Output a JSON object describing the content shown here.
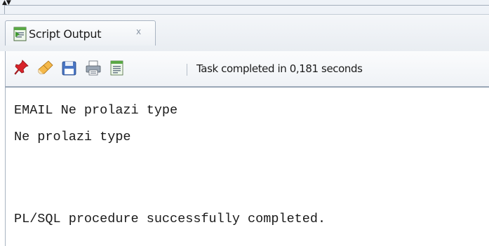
{
  "window": {
    "arrows": "▲▼"
  },
  "tab": {
    "label": "Script Output",
    "close": "x",
    "icon": "script-output-icon"
  },
  "toolbar": {
    "buttons": [
      {
        "name": "pin",
        "icon": "pin-icon"
      },
      {
        "name": "clear",
        "icon": "eraser-icon"
      },
      {
        "name": "save",
        "icon": "floppy-disk-icon"
      },
      {
        "name": "print",
        "icon": "printer-icon"
      },
      {
        "name": "open",
        "icon": "document-icon"
      }
    ],
    "status": "Task completed in 0,181 seconds"
  },
  "output": {
    "lines": [
      "EMAIL Ne prolazi type",
      "Ne prolazi type",
      "",
      "",
      "PL/SQL procedure successfully completed."
    ]
  },
  "colors": {
    "accent_green": "#3f9a2e",
    "pin_red": "#d8232a",
    "border": "#a9b4c2"
  }
}
